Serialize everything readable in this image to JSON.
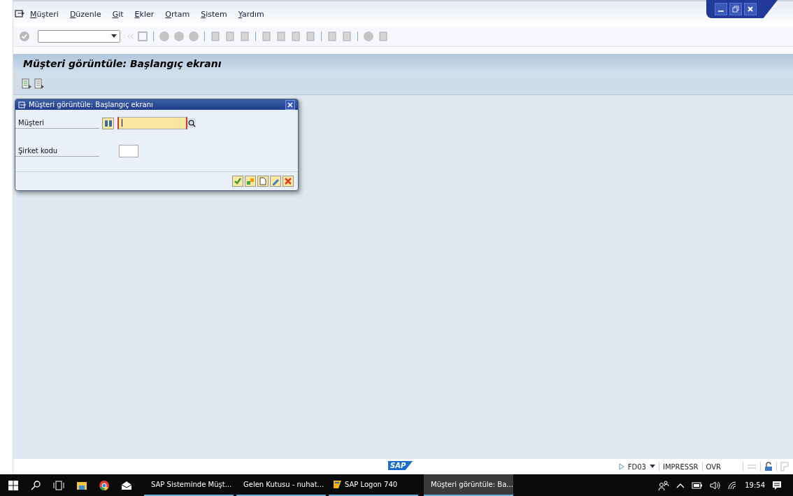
{
  "menu": [
    "Müşteri",
    "Düzenle",
    "Git",
    "Ekler",
    "Ortam",
    "Sistem",
    "Yardım"
  ],
  "screen_title": "Müşteri görüntüle: Başlangıç ekranı",
  "dialog": {
    "title": "Müşteri görüntüle: Başlangıç ekranı",
    "fields": [
      {
        "label": "Müşteri",
        "required": true,
        "focused": true
      },
      {
        "label": "Şirket kodu",
        "required": false,
        "focused": false
      }
    ]
  },
  "status_bar": {
    "logo": "SAP",
    "transaction": "FD03",
    "server": "IMPRESSR",
    "mode": "OVR"
  },
  "taskbar": {
    "apps": [
      {
        "label": "SAP Sisteminde Müşt...",
        "kind": "word",
        "selected": false
      },
      {
        "label": "Gelen Kutusu - nuhat...",
        "kind": "outlook",
        "selected": false
      },
      {
        "label": "SAP Logon 740",
        "kind": "logon",
        "selected": false
      },
      {
        "label": "Müşteri görüntüle: Ba...",
        "kind": "sapgui",
        "selected": true
      }
    ],
    "time": "19:54"
  }
}
